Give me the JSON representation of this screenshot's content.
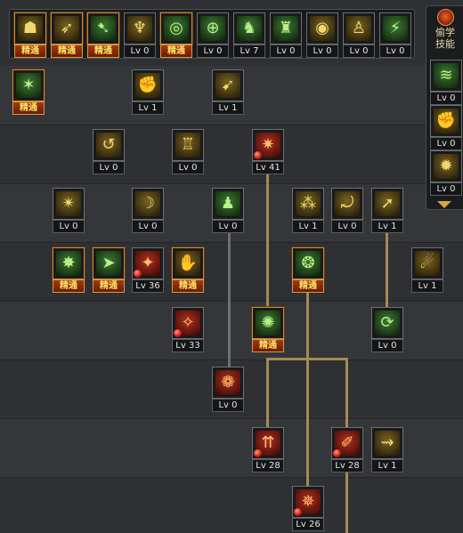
{
  "colors": {
    "background": "#2b2d30",
    "connector_gold": "#a58a52",
    "connector_grey": "#6d6f72",
    "mastered_border": "#c98c3a",
    "mastered_label_text": "#ffe06a"
  },
  "sidebar": {
    "title_line1": "偷学",
    "title_line2": "技能",
    "badge_icon": "fire-orb-icon",
    "scroll_icon": "triangle-down-icon"
  },
  "topbar_skills": [
    {
      "label": "精通",
      "icon": "reclining-fighter-icon",
      "tone": "gold",
      "mastered": true
    },
    {
      "label": "精通",
      "icon": "lunge-attack-icon",
      "tone": "gold",
      "mastered": true
    },
    {
      "label": "精通",
      "icon": "running-fighter-icon",
      "tone": "green",
      "mastered": true
    },
    {
      "label": "Lv 0",
      "icon": "eagle-wings-icon",
      "tone": "gold",
      "mastered": false
    },
    {
      "label": "精通",
      "icon": "crosshair-target-icon",
      "tone": "green",
      "mastered": true
    },
    {
      "label": "Lv 0",
      "icon": "crosshair-scope-icon",
      "tone": "green",
      "mastered": false
    },
    {
      "label": "Lv 7",
      "icon": "crouching-fighter-icon",
      "tone": "green",
      "mastered": false
    },
    {
      "label": "Lv 0",
      "icon": "helmet-soldier-icon",
      "tone": "green",
      "mastered": false
    },
    {
      "label": "Lv 0",
      "icon": "spiral-eye-icon",
      "tone": "gold",
      "mastered": false
    },
    {
      "label": "Lv 0",
      "icon": "power-pose-icon",
      "tone": "gold",
      "mastered": false
    },
    {
      "label": "Lv 0",
      "icon": "kick-fighter-icon",
      "tone": "green",
      "mastered": false
    }
  ],
  "sidebar_skills": [
    {
      "label": "Lv 0",
      "icon": "wind-slash-icon",
      "tone": "green",
      "mastered": false
    },
    {
      "label": "Lv 0",
      "icon": "fist-strike-icon",
      "tone": "gold",
      "mastered": false
    },
    {
      "label": "Lv 0",
      "icon": "flame-drop-icon",
      "tone": "gold",
      "mastered": false
    }
  ],
  "tree_skills": [
    {
      "label": "精通",
      "icon": "slash-burst-icon",
      "tone": "green",
      "mastered": true,
      "gem": false
    },
    {
      "label": "Lv 1",
      "icon": "armored-fist-icon",
      "tone": "gold",
      "mastered": false,
      "gem": false
    },
    {
      "label": "Lv 1",
      "icon": "leaping-strike-icon",
      "tone": "gold",
      "mastered": false,
      "gem": false
    },
    {
      "label": "Lv 0",
      "icon": "spiral-kick-icon",
      "tone": "gold",
      "mastered": false,
      "gem": false
    },
    {
      "label": "Lv 0",
      "icon": "guard-stance-icon",
      "tone": "gold",
      "mastered": false,
      "gem": false
    },
    {
      "label": "Lv 41",
      "icon": "ground-smash-icon",
      "tone": "red",
      "mastered": false,
      "gem": true
    },
    {
      "label": "Lv 0",
      "icon": "shuriken-burst-icon",
      "tone": "gold",
      "mastered": false,
      "gem": false
    },
    {
      "label": "Lv 0",
      "icon": "arc-strike-icon",
      "tone": "gold",
      "mastered": false,
      "gem": false
    },
    {
      "label": "Lv 0",
      "icon": "muscle-body-icon",
      "tone": "green",
      "mastered": false,
      "gem": false
    },
    {
      "label": "Lv 1",
      "icon": "multi-hit-icon",
      "tone": "gold",
      "mastered": false,
      "gem": false
    },
    {
      "label": "Lv 0",
      "icon": "grapple-throw-icon",
      "tone": "gold",
      "mastered": false,
      "gem": false
    },
    {
      "label": "Lv 1",
      "icon": "flying-kick-icon",
      "tone": "gold",
      "mastered": false,
      "gem": false
    },
    {
      "label": "精通",
      "icon": "energy-star-icon",
      "tone": "green",
      "mastered": true,
      "gem": false
    },
    {
      "label": "精通",
      "icon": "dash-runner-icon",
      "tone": "green",
      "mastered": true,
      "gem": false
    },
    {
      "label": "Lv 36",
      "icon": "point-blank-icon",
      "tone": "red",
      "mastered": false,
      "gem": true
    },
    {
      "label": "精通",
      "icon": "palm-thrust-icon",
      "tone": "gold",
      "mastered": true,
      "gem": false
    },
    {
      "label": "精通",
      "icon": "shockwave-icon",
      "tone": "green",
      "mastered": true,
      "gem": false
    },
    {
      "label": "Lv 1",
      "icon": "fireball-icon",
      "tone": "gold",
      "mastered": false,
      "gem": false
    },
    {
      "label": "Lv 33",
      "icon": "blade-flare-icon",
      "tone": "red",
      "mastered": false,
      "gem": true
    },
    {
      "label": "精通",
      "icon": "dragon-burst-icon",
      "tone": "green",
      "mastered": true,
      "gem": false
    },
    {
      "label": "Lv 0",
      "icon": "spin-strike-icon",
      "tone": "green",
      "mastered": false,
      "gem": false
    },
    {
      "label": "Lv 0",
      "icon": "rolling-body-icon",
      "tone": "red",
      "mastered": false,
      "gem": false
    },
    {
      "label": "Lv 28",
      "icon": "rising-uppercut-icon",
      "tone": "red",
      "mastered": false,
      "gem": true
    },
    {
      "label": "Lv 28",
      "icon": "iron-gauntlet-icon",
      "tone": "red",
      "mastered": false,
      "gem": true
    },
    {
      "label": "Lv 1",
      "icon": "ground-slide-icon",
      "tone": "gold",
      "mastered": false,
      "gem": false
    },
    {
      "label": "Lv 26",
      "icon": "fury-awakening-icon",
      "tone": "red",
      "mastered": false,
      "gem": true
    }
  ]
}
